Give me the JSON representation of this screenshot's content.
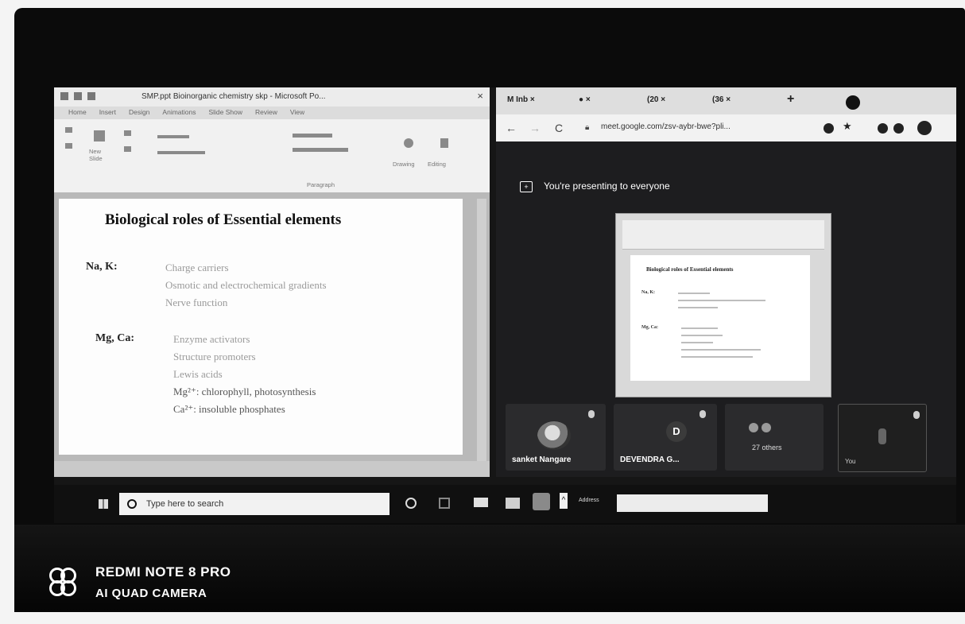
{
  "ppt": {
    "window_title": "SMP.ppt Bioinorganic chemistry skp - Microsoft Po...",
    "close_glyph": "×",
    "tabs": [
      "Home",
      "Insert",
      "Design",
      "Animations",
      "Slide Show",
      "Review",
      "View"
    ],
    "ribbon": {
      "new_slide": "New Slide",
      "drawing": "Drawing",
      "editing": "Editing",
      "paragraph": "Paragraph"
    },
    "slide": {
      "title": "Biological roles of Essential elements",
      "groups": [
        {
          "label": "Na, K:",
          "lines": [
            "Charge carriers",
            "Osmotic and electrochemical gradients",
            "Nerve function"
          ]
        },
        {
          "label": "Mg, Ca:",
          "lines": [
            "Enzyme activators",
            "Structure promoters",
            "Lewis acids",
            "Mg²⁺: chlorophyll, photosynthesis",
            "Ca²⁺: insoluble phosphates"
          ]
        }
      ]
    }
  },
  "chrome": {
    "tabs": [
      {
        "label": "M  Inb  ×"
      },
      {
        "label": "● ×"
      },
      {
        "label": "(20  ×"
      },
      {
        "label": "(36  ×"
      }
    ],
    "new_tab": "+",
    "nav": {
      "back": "←",
      "forward": "→",
      "reload": "C"
    },
    "url": "meet.google.com/zsv-aybr-bwe?pli..."
  },
  "meet": {
    "presenting_text": "You're presenting to everyone",
    "preview": {
      "title": "Biological roles of Essential elements",
      "labels": [
        "Na, K:",
        "Mg, Ca:"
      ]
    },
    "participants": [
      {
        "name": "sanket Nangare"
      },
      {
        "name": "DEVENDRA G...",
        "initial": "D"
      },
      {
        "name": "27 others"
      },
      {
        "name": "You"
      }
    ]
  },
  "taskbar": {
    "search_placeholder": "Type here to search",
    "address_label": "Address"
  },
  "watermark": {
    "line1": "REDMI NOTE 8 PRO",
    "line2": "AI QUAD CAMERA"
  },
  "colors": {
    "meet_bg": "#1d1d1f",
    "taskbar_bg": "#101010",
    "slide_bg": "#fdfdfd"
  }
}
